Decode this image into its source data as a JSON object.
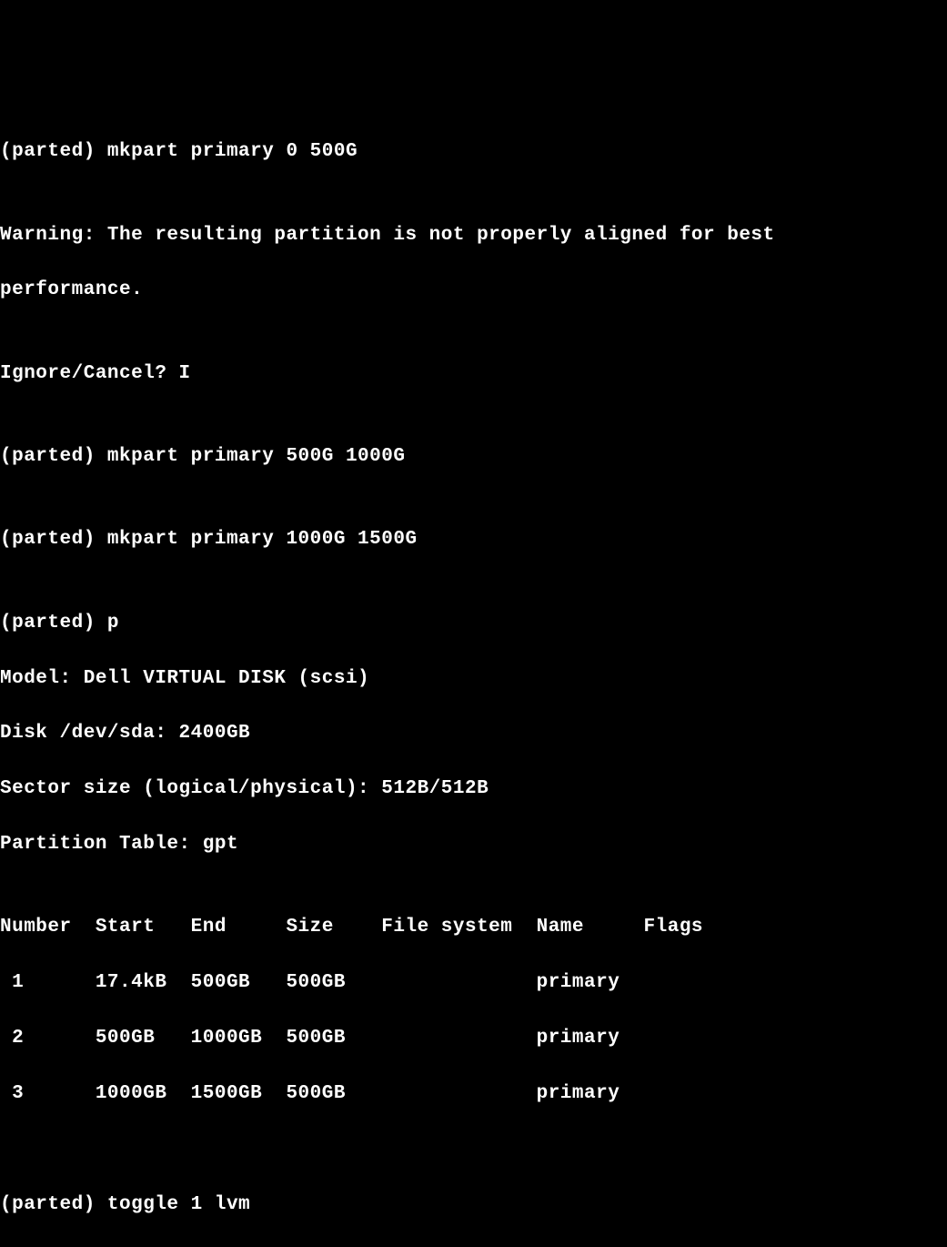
{
  "lines": {
    "l0": "(parted) mkpart primary 0 500G",
    "l1": "",
    "l2": "Warning: The resulting partition is not properly aligned for best",
    "l3": "performance.",
    "l4": "",
    "l5": "Ignore/Cancel? I",
    "l6": "",
    "l7": "(parted) mkpart primary 500G 1000G",
    "l8": "",
    "l9": "(parted) mkpart primary 1000G 1500G",
    "l10": "",
    "l11": "(parted) p",
    "l12": "Model: Dell VIRTUAL DISK (scsi)",
    "l13": "Disk /dev/sda: 2400GB",
    "l14": "Sector size (logical/physical): 512B/512B",
    "l15": "Partition Table: gpt",
    "l16": "",
    "l17": "Number  Start   End     Size    File system  Name     Flags",
    "l18": " 1      17.4kB  500GB   500GB                primary",
    "l19": " 2      500GB   1000GB  500GB                primary",
    "l20": " 3      1000GB  1500GB  500GB                primary",
    "l21": "",
    "l22": "",
    "l23": "(parted) toggle 1 lvm"
  }
}
